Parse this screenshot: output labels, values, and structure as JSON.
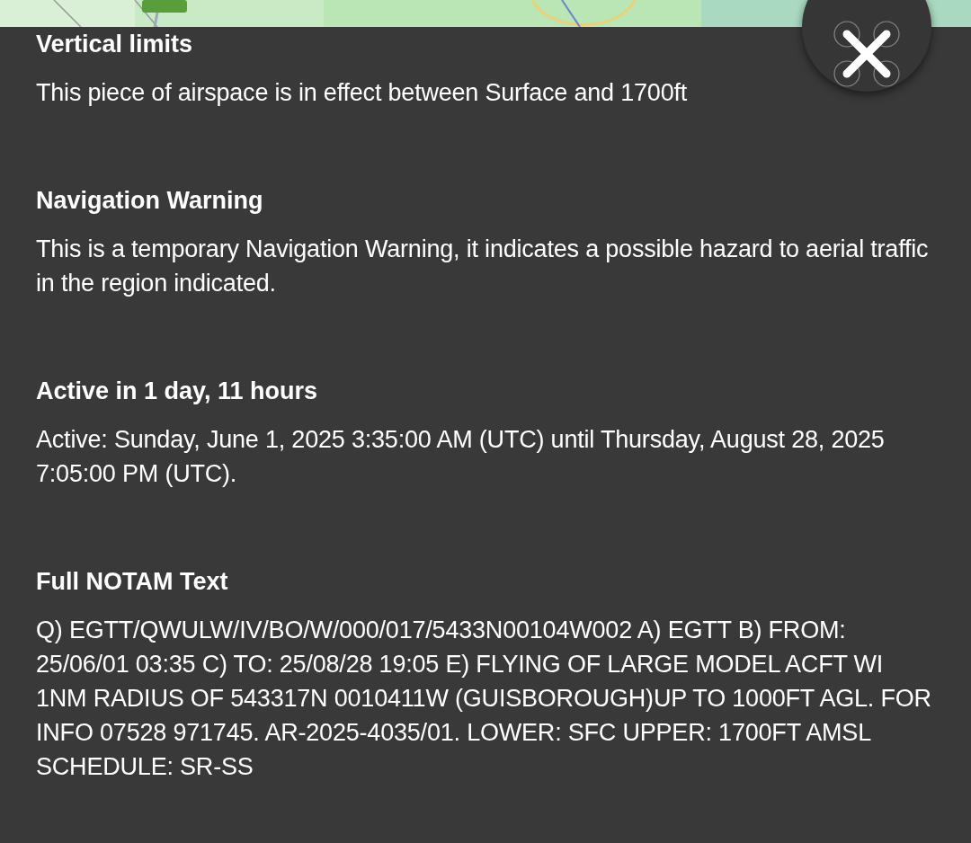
{
  "sections": [
    {
      "heading": "Vertical limits",
      "body": "This piece of airspace is in effect between Surface and 1700ft"
    },
    {
      "heading": "Navigation Warning",
      "body": "This is a temporary Navigation Warning, it indicates a possible hazard to aerial traffic in the region indicated."
    },
    {
      "heading": "Active in 1 day, 11 hours",
      "body": "Active: Sunday, June 1, 2025 3:35:00 AM (UTC) until Thursday, August 28, 2025 7:05:00 PM (UTC)."
    },
    {
      "heading": "Full NOTAM Text",
      "body": "Q) EGTT/QWULW/IV/BO/W/000/017/5433N00104W002 A) EGTT B) FROM: 25/06/01 03:35 C) TO: 25/08/28 19:05 E) FLYING OF LARGE MODEL ACFT WI 1NM RADIUS OF 543317N 0010411W (GUISBOROUGH)UP TO 1000FT AGL. FOR INFO 07528 971745. AR-2025-4035/01. LOWER: SFC UPPER: 1700FT AMSL SCHEDULE: SR-SS"
    }
  ]
}
